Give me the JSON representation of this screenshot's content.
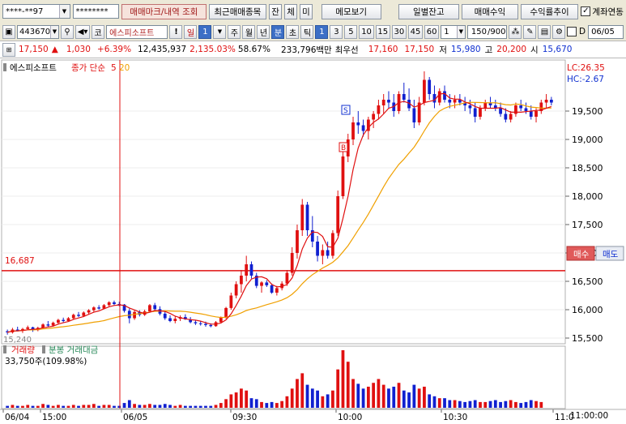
{
  "toolbar1": {
    "account": "****-**97",
    "password": "********",
    "mark_btn": "매매마크/내역 조회",
    "recent_btn": "최근매매종목",
    "tab_jan": "잔",
    "tab_che": "체",
    "tab_mi": "미",
    "memo_btn": "메모보기",
    "daily_btn": "일별잔고",
    "trade_profit_btn": "매매수익",
    "profit_trend_btn": "수익률추이",
    "account_link_label": "계좌연동",
    "account_link_checked": true
  },
  "toolbar2": {
    "code": "443670",
    "market": "코",
    "name": "에스피소프트",
    "excl": "!",
    "period": "일",
    "period_num": "1",
    "periods": [
      "주",
      "월",
      "년"
    ],
    "minute": "분",
    "cho": "초",
    "tick": "틱",
    "intervals": [
      "1",
      "3",
      "5",
      "10",
      "15",
      "30",
      "45",
      "60"
    ],
    "sel_interval": "1",
    "count": "150",
    "count_max": "/900",
    "d_label": "D",
    "date": "06/05"
  },
  "quote": {
    "price": "17,150",
    "price_arrow": "▲",
    "change": "1,030",
    "change_pct": "+6.39%",
    "volume": "12,435,937",
    "vol_ratio": "2,135.03%",
    "turnover": "58.67%",
    "amount": "233,796백만",
    "pri_label": "최우선",
    "ask": "17,160",
    "bid": "17,150",
    "low_label": "저",
    "low": "15,980",
    "high_label": "고",
    "high": "20,200",
    "open_label": "시",
    "open": "15,670"
  },
  "chart": {
    "stock_label": "에스피소프트",
    "ma_label": "종가 단순",
    "ma_short": "5",
    "ma_long": "20",
    "lc_label": "LC:26.35",
    "hc_label": "HC:-2.67",
    "buy_btn": "매수",
    "sell_btn": "매도",
    "hline_label": "16,687",
    "min_label": "15,240",
    "vol_title": "거래량",
    "vol_sub": "분봉 거래대금",
    "vol_value": "33,750주(109.98%)",
    "marker_s": "S",
    "marker_b": "B",
    "y_ticks": [
      "19,500",
      "19,000",
      "18,500",
      "18,000",
      "17,500",
      "17,000",
      "16,500",
      "16,000",
      "15,500"
    ],
    "x_ticks": [
      "06/04",
      "15:00",
      "06/05",
      "09:30",
      "10:00",
      "10:30",
      "11:0"
    ],
    "x_right": "11:00:00",
    "colors": {
      "up": "#e01010",
      "down": "#1020d0",
      "ma5": "#e01010",
      "ma20": "#f0a000"
    }
  },
  "chart_data": {
    "type": "candlestick",
    "y_range": [
      15400,
      20400
    ],
    "hline": 16687,
    "candles": [
      [
        15620,
        15650,
        15560,
        15600
      ],
      [
        15600,
        15680,
        15580,
        15650
      ],
      [
        15650,
        15700,
        15620,
        15630
      ],
      [
        15630,
        15680,
        15590,
        15660
      ],
      [
        15660,
        15720,
        15640,
        15690
      ],
      [
        15690,
        15700,
        15610,
        15640
      ],
      [
        15640,
        15700,
        15620,
        15680
      ],
      [
        15680,
        15760,
        15660,
        15740
      ],
      [
        15740,
        15800,
        15700,
        15720
      ],
      [
        15720,
        15790,
        15700,
        15770
      ],
      [
        15770,
        15840,
        15740,
        15820
      ],
      [
        15820,
        15860,
        15780,
        15800
      ],
      [
        15800,
        15870,
        15790,
        15850
      ],
      [
        15850,
        15930,
        15830,
        15910
      ],
      [
        15910,
        15960,
        15870,
        15890
      ],
      [
        15890,
        15970,
        15870,
        15950
      ],
      [
        15950,
        16010,
        15920,
        15990
      ],
      [
        15990,
        16060,
        15960,
        16040
      ],
      [
        16040,
        16080,
        16000,
        16020
      ],
      [
        16020,
        16100,
        16010,
        16080
      ],
      [
        16080,
        16150,
        16060,
        16130
      ],
      [
        16130,
        16160,
        16080,
        16100
      ],
      [
        16100,
        16140,
        16060,
        16090
      ],
      [
        16090,
        16100,
        15950,
        15980
      ],
      [
        15980,
        16020,
        15760,
        15850
      ],
      [
        15850,
        16000,
        15820,
        15960
      ],
      [
        15960,
        15990,
        15880,
        15910
      ],
      [
        15910,
        16000,
        15890,
        15970
      ],
      [
        15970,
        16100,
        15950,
        16080
      ],
      [
        16080,
        16120,
        15990,
        16010
      ],
      [
        16010,
        16060,
        15900,
        15930
      ],
      [
        15930,
        15980,
        15820,
        15850
      ],
      [
        15850,
        15900,
        15780,
        15800
      ],
      [
        15800,
        15880,
        15760,
        15840
      ],
      [
        15840,
        15900,
        15800,
        15870
      ],
      [
        15870,
        15920,
        15820,
        15830
      ],
      [
        15830,
        15870,
        15760,
        15780
      ],
      [
        15780,
        15820,
        15730,
        15760
      ],
      [
        15760,
        15800,
        15720,
        15750
      ],
      [
        15750,
        15790,
        15700,
        15730
      ],
      [
        15730,
        15760,
        15690,
        15710
      ],
      [
        15710,
        15800,
        15700,
        15780
      ],
      [
        15780,
        15880,
        15760,
        15860
      ],
      [
        15860,
        16050,
        15840,
        16030
      ],
      [
        16030,
        16300,
        16000,
        16250
      ],
      [
        16250,
        16500,
        16200,
        16450
      ],
      [
        16450,
        16700,
        16300,
        16600
      ],
      [
        16600,
        16950,
        16500,
        16800
      ],
      [
        16800,
        16850,
        16550,
        16600
      ],
      [
        16600,
        16650,
        16380,
        16420
      ],
      [
        16420,
        16500,
        16300,
        16480
      ],
      [
        16480,
        16520,
        16400,
        16430
      ],
      [
        16430,
        16460,
        16280,
        16300
      ],
      [
        16300,
        16420,
        16250,
        16380
      ],
      [
        16380,
        16500,
        16340,
        16460
      ],
      [
        16460,
        16700,
        16420,
        16650
      ],
      [
        16650,
        17100,
        16600,
        17000
      ],
      [
        17000,
        17500,
        16900,
        17400
      ],
      [
        17400,
        17950,
        17300,
        17850
      ],
      [
        17850,
        17900,
        17300,
        17400
      ],
      [
        17400,
        17650,
        17100,
        17200
      ],
      [
        17200,
        17300,
        16850,
        16950
      ],
      [
        16950,
        17150,
        16800,
        17050
      ],
      [
        17050,
        17200,
        16900,
        16950
      ],
      [
        16950,
        17400,
        16900,
        17350
      ],
      [
        17350,
        18100,
        17300,
        18000
      ],
      [
        18000,
        18800,
        17950,
        18700
      ],
      [
        18700,
        19100,
        18600,
        19000
      ],
      [
        19000,
        19400,
        18900,
        19300
      ],
      [
        19300,
        19500,
        19100,
        19250
      ],
      [
        19250,
        19350,
        19050,
        19150
      ],
      [
        19150,
        19400,
        19000,
        19350
      ],
      [
        19350,
        19500,
        19200,
        19450
      ],
      [
        19450,
        19700,
        19350,
        19600
      ],
      [
        19600,
        19800,
        19450,
        19700
      ],
      [
        19700,
        19850,
        19550,
        19650
      ],
      [
        19650,
        19800,
        19400,
        19500
      ],
      [
        19500,
        19850,
        19450,
        19800
      ],
      [
        19800,
        20000,
        19650,
        19700
      ],
      [
        19700,
        19900,
        19500,
        19550
      ],
      [
        19550,
        19700,
        19200,
        19300
      ],
      [
        19300,
        19750,
        19250,
        19650
      ],
      [
        19650,
        20200,
        19600,
        20050
      ],
      [
        20050,
        20100,
        19700,
        19800
      ],
      [
        19800,
        19950,
        19550,
        19650
      ],
      [
        19650,
        19900,
        19600,
        19850
      ],
      [
        19850,
        19950,
        19650,
        19700
      ],
      [
        19700,
        19800,
        19550,
        19650
      ],
      [
        19650,
        19780,
        19550,
        19700
      ],
      [
        19700,
        19800,
        19600,
        19650
      ],
      [
        19650,
        19750,
        19500,
        19600
      ],
      [
        19600,
        19700,
        19450,
        19550
      ],
      [
        19550,
        19650,
        19300,
        19400
      ],
      [
        19400,
        19600,
        19350,
        19550
      ],
      [
        19550,
        19700,
        19500,
        19650
      ],
      [
        19650,
        19750,
        19550,
        19600
      ],
      [
        19600,
        19700,
        19500,
        19550
      ],
      [
        19550,
        19650,
        19400,
        19450
      ],
      [
        19450,
        19550,
        19300,
        19350
      ],
      [
        19350,
        19500,
        19300,
        19450
      ],
      [
        19450,
        19650,
        19400,
        19600
      ],
      [
        19600,
        19700,
        19500,
        19550
      ],
      [
        19550,
        19650,
        19450,
        19500
      ],
      [
        19500,
        19600,
        19350,
        19400
      ],
      [
        19400,
        19550,
        19300,
        19500
      ],
      [
        19500,
        19700,
        19450,
        19650
      ],
      [
        19650,
        19800,
        19550,
        19700
      ],
      [
        19700,
        19750,
        19600,
        19650
      ]
    ],
    "volumes": [
      2,
      3,
      2,
      2,
      3,
      2,
      2,
      4,
      3,
      2,
      3,
      2,
      2,
      3,
      2,
      3,
      3,
      4,
      2,
      3,
      3,
      2,
      2,
      5,
      8,
      4,
      3,
      3,
      4,
      3,
      3,
      4,
      3,
      2,
      3,
      2,
      2,
      2,
      2,
      2,
      2,
      3,
      5,
      9,
      14,
      16,
      20,
      18,
      10,
      9,
      6,
      5,
      6,
      5,
      7,
      12,
      20,
      30,
      36,
      24,
      20,
      18,
      12,
      14,
      18,
      40,
      60,
      48,
      30,
      25,
      20,
      22,
      26,
      30,
      24,
      20,
      22,
      26,
      18,
      16,
      24,
      20,
      22,
      14,
      12,
      10,
      10,
      8,
      8,
      7,
      6,
      7,
      8,
      6,
      6,
      7,
      8,
      6,
      7,
      8,
      6,
      5,
      6,
      8,
      7,
      6
    ]
  }
}
